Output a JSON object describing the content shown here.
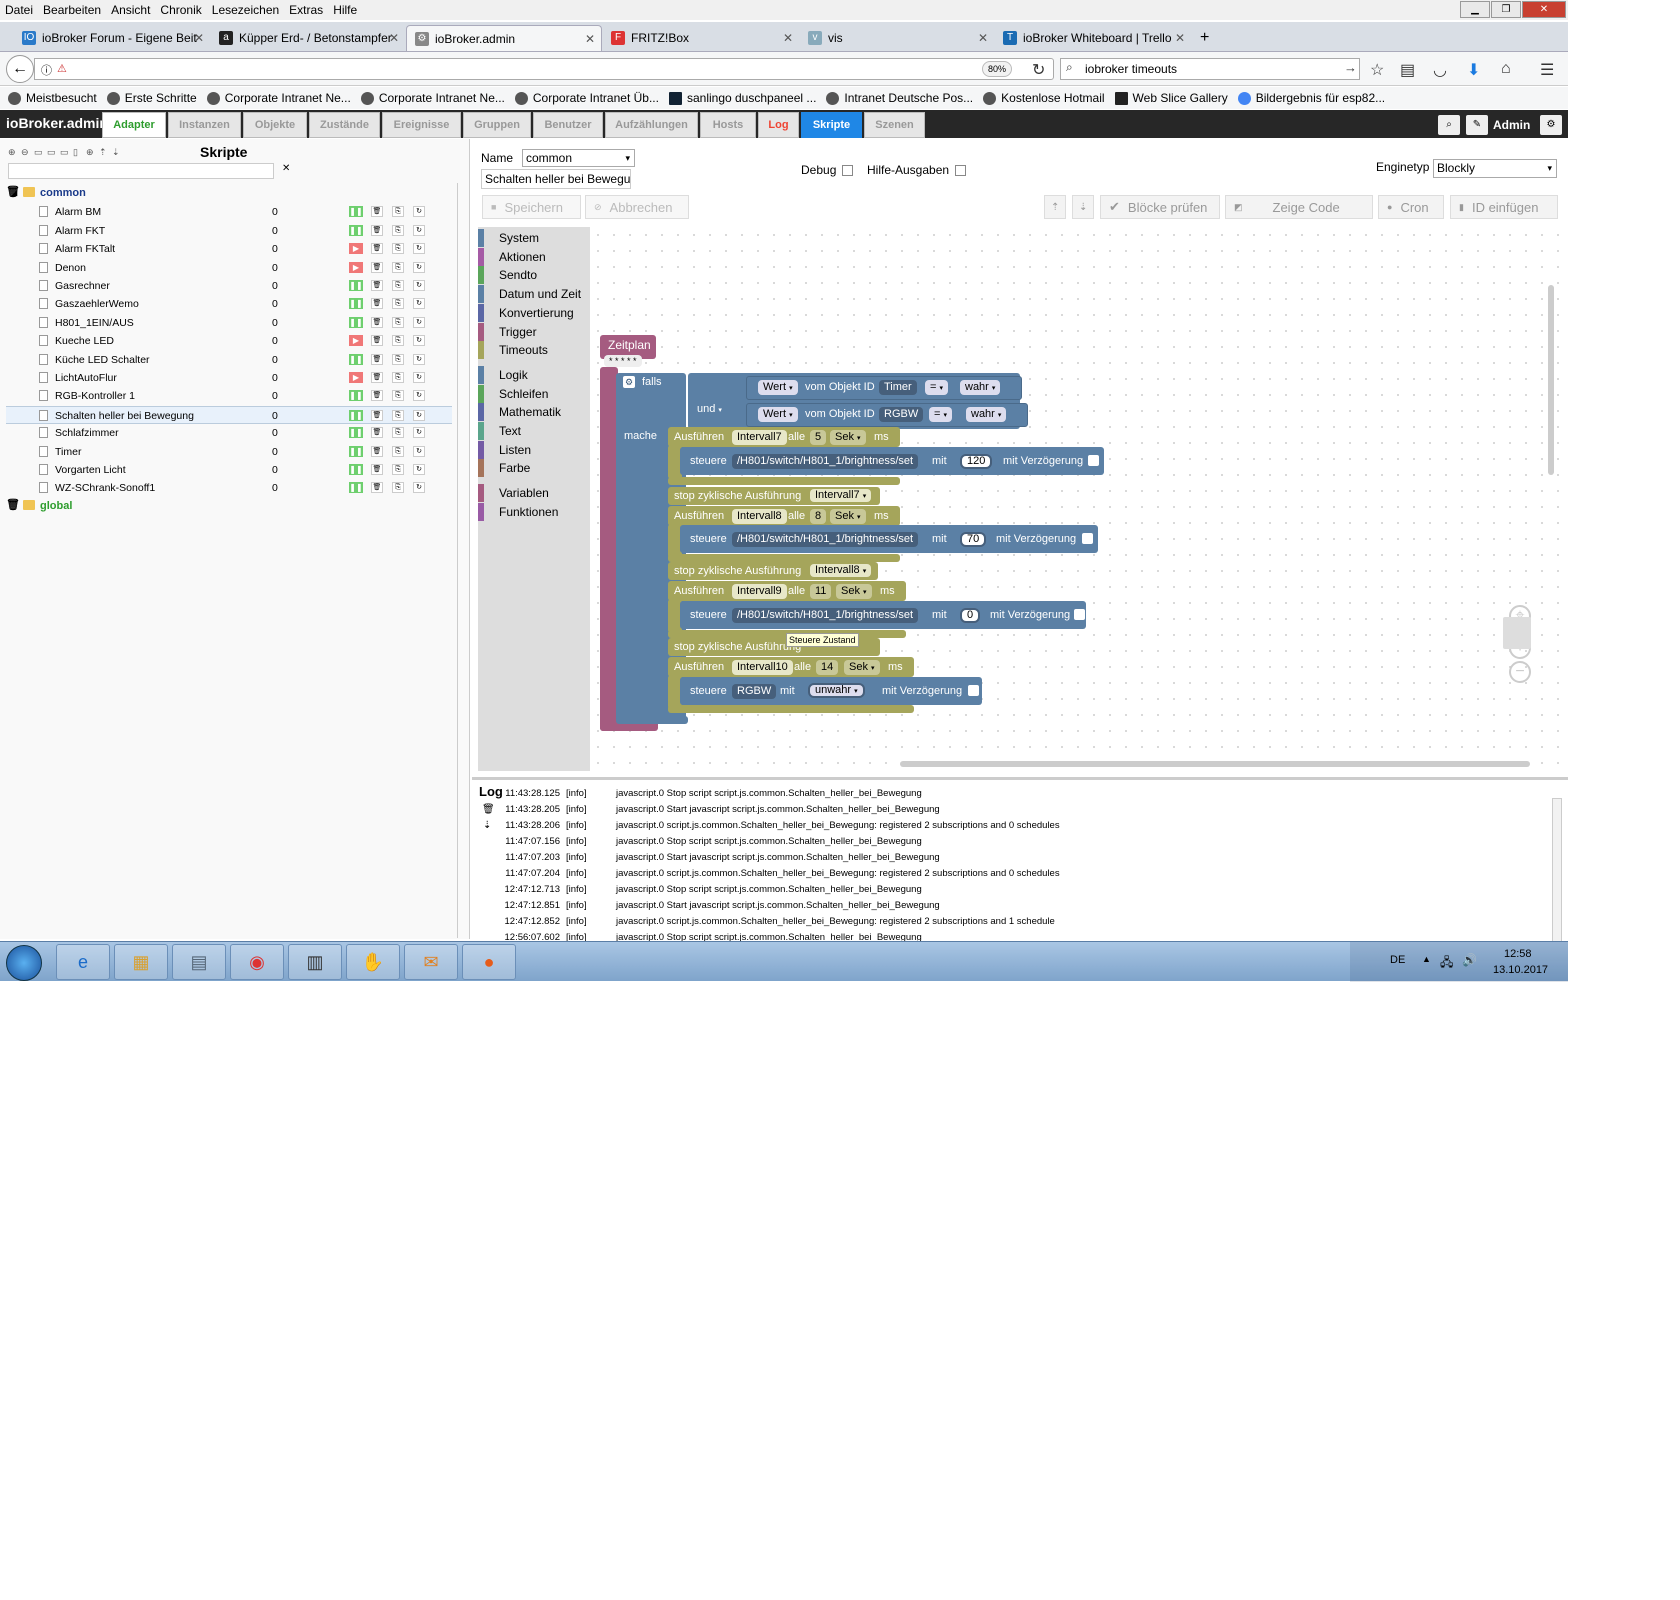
{
  "menu": [
    "Datei",
    "Bearbeiten",
    "Ansicht",
    "Chronik",
    "Lesezeichen",
    "Extras",
    "Hilfe"
  ],
  "tabs": [
    {
      "label": "ioBroker Forum - Eigene Beit",
      "icon": "IO",
      "color": "#2a7ac9"
    },
    {
      "label": "Küpper Erd- / Betonstampfer",
      "icon": "a",
      "color": "#222"
    },
    {
      "label": "ioBroker.admin",
      "icon": "⚙",
      "color": "#666"
    },
    {
      "label": "FRITZ!Box",
      "icon": "F",
      "color": "#d33"
    },
    {
      "label": "vis",
      "icon": "v",
      "color": "#7aa"
    },
    {
      "label": "ioBroker Whiteboard | Trello",
      "icon": "T",
      "color": "#1a6bb3"
    }
  ],
  "nav": {
    "zoom": "80%",
    "search_value": "iobroker timeouts"
  },
  "bookmarks": [
    "Meistbesucht",
    "Erste Schritte",
    "Corporate Intranet Ne...",
    "Corporate Intranet Ne...",
    "Corporate Intranet Üb...",
    "sanlingo duschpaneel ...",
    "Intranet Deutsche Pos...",
    "Kostenlose Hotmail",
    "Web Slice Gallery",
    "Bildergebnis für esp82..."
  ],
  "app": {
    "brand": "ioBroker.admin",
    "tabs": [
      "Adapter",
      "Instanzen",
      "Objekte",
      "Zustände",
      "Ereignisse",
      "Gruppen",
      "Benutzer",
      "Aufzählungen",
      "Hosts",
      "Log",
      "Skripte",
      "Szenen"
    ],
    "user": "Admin"
  },
  "scripts": {
    "title": "Skripte",
    "common_folder": "common",
    "global_folder": "global",
    "items": [
      {
        "name": "Alarm BM",
        "value": "0",
        "running": true
      },
      {
        "name": "Alarm FKT",
        "value": "0",
        "running": true
      },
      {
        "name": "Alarm FKTalt",
        "value": "0",
        "running": false
      },
      {
        "name": "Denon",
        "value": "0",
        "running": false
      },
      {
        "name": "Gasrechner",
        "value": "0",
        "running": true
      },
      {
        "name": "GaszaehlerWemo",
        "value": "0",
        "running": true
      },
      {
        "name": "H801_1EIN/AUS",
        "value": "0",
        "running": true
      },
      {
        "name": "Kueche LED",
        "value": "0",
        "running": false
      },
      {
        "name": "Küche LED Schalter",
        "value": "0",
        "running": true
      },
      {
        "name": "LichtAutoFlur",
        "value": "0",
        "running": false
      },
      {
        "name": "RGB-Kontroller 1",
        "value": "0",
        "running": true
      },
      {
        "name": "Schalten heller bei Bewegung",
        "value": "0",
        "running": true
      },
      {
        "name": "Schlafzimmer",
        "value": "0",
        "running": true
      },
      {
        "name": "Timer",
        "value": "0",
        "running": true
      },
      {
        "name": "Vorgarten Licht",
        "value": "0",
        "running": true
      },
      {
        "name": "WZ-SChrank-Sonoff1",
        "value": "0",
        "running": true
      }
    ]
  },
  "editor": {
    "name_label": "Name",
    "name_value": "common",
    "script_name": "Schalten heller bei Bewegung",
    "debug_label": "Debug",
    "hilfe_label": "Hilfe-Ausgaben",
    "engine_label": "Enginetyp",
    "engine_value": "Blockly",
    "save_label": "Speichern",
    "cancel_label": "Abbrechen",
    "check_label": "Blöcke prüfen",
    "code_label": "Zeige Code",
    "cron_label": "Cron",
    "id_label": "ID einfügen"
  },
  "toolbox": [
    {
      "label": "System",
      "color": "#5b80a5"
    },
    {
      "label": "Aktionen",
      "color": "#a55ba5"
    },
    {
      "label": "Sendto",
      "color": "#5ba55b"
    },
    {
      "label": "Datum und Zeit",
      "color": "#5b80a5"
    },
    {
      "label": "Konvertierung",
      "color": "#5b67a5"
    },
    {
      "label": "Trigger",
      "color": "#a55b80"
    },
    {
      "label": "Timeouts",
      "color": "#a5a55b"
    },
    {
      "label": "Logik",
      "color": "#5b80a5"
    },
    {
      "label": "Schleifen",
      "color": "#5ba55b"
    },
    {
      "label": "Mathematik",
      "color": "#5b67a5"
    },
    {
      "label": "Text",
      "color": "#5ba58c"
    },
    {
      "label": "Listen",
      "color": "#745ba5"
    },
    {
      "label": "Farbe",
      "color": "#a5745b"
    },
    {
      "label": "Variablen",
      "color": "#a55b80"
    },
    {
      "label": "Funktionen",
      "color": "#995ba5"
    }
  ],
  "blocks": {
    "zeitplan": "Zeitplan",
    "cron": "* * * * *",
    "falls": "falls",
    "und": "und",
    "mache": "mache",
    "wert": "Wert",
    "vom_objekt": "vom Objekt ID",
    "timer": "Timer",
    "rgbw": "RGBW",
    "eq": "=",
    "wahr": "wahr",
    "ausfuehren": "Ausführen",
    "alle": "alle",
    "sek": "Sek",
    "ms": "ms",
    "steuere": "steuere",
    "mit": "mit",
    "mit_verz": "mit Verzögerung",
    "stop": "stop zyklische Ausführung",
    "path": "/H801/switch/H801_1/brightness/set",
    "unwahr": "unwahr",
    "tooltip": "Steuere Zustand",
    "intervals": [
      {
        "name": "Intervall7",
        "every": "5",
        "value": "120"
      },
      {
        "name": "Intervall8",
        "every": "8",
        "value": "70"
      },
      {
        "name": "Intervall9",
        "every": "11",
        "value": "0"
      },
      {
        "name": "Intervall10",
        "every": "14"
      }
    ]
  },
  "log": {
    "title": "Log",
    "lines": [
      {
        "time": "11:43:28.125",
        "level": "[info]",
        "msg": "javascript.0 Stop script script.js.common.Schalten_heller_bei_Bewegung"
      },
      {
        "time": "11:43:28.205",
        "level": "[info]",
        "msg": "javascript.0 Start javascript script.js.common.Schalten_heller_bei_Bewegung"
      },
      {
        "time": "11:43:28.206",
        "level": "[info]",
        "msg": "javascript.0 script.js.common.Schalten_heller_bei_Bewegung: registered 2 subscriptions and 0 schedules"
      },
      {
        "time": "11:47:07.156",
        "level": "[info]",
        "msg": "javascript.0 Stop script script.js.common.Schalten_heller_bei_Bewegung"
      },
      {
        "time": "11:47:07.203",
        "level": "[info]",
        "msg": "javascript.0 Start javascript script.js.common.Schalten_heller_bei_Bewegung"
      },
      {
        "time": "11:47:07.204",
        "level": "[info]",
        "msg": "javascript.0 script.js.common.Schalten_heller_bei_Bewegung: registered 2 subscriptions and 0 schedules"
      },
      {
        "time": "12:47:12.713",
        "level": "[info]",
        "msg": "javascript.0 Stop script script.js.common.Schalten_heller_bei_Bewegung"
      },
      {
        "time": "12:47:12.851",
        "level": "[info]",
        "msg": "javascript.0 Start javascript script.js.common.Schalten_heller_bei_Bewegung"
      },
      {
        "time": "12:47:12.852",
        "level": "[info]",
        "msg": "javascript.0 script.js.common.Schalten_heller_bei_Bewegung: registered 2 subscriptions and 1 schedule"
      },
      {
        "time": "12:56:07.602",
        "level": "[info]",
        "msg": "javascript.0 Stop script script.js.common.Schalten_heller_bei_Bewegung"
      }
    ]
  },
  "taskbar": {
    "lang": "DE",
    "time": "12:58",
    "date": "13.10.2017",
    "apps": [
      "internet-explorer-icon",
      "explorer-icon",
      "calculator-icon",
      "chrome-icon",
      "barcode-app-icon",
      "handshake-app-icon",
      "outlook-icon",
      "firefox-icon"
    ]
  }
}
